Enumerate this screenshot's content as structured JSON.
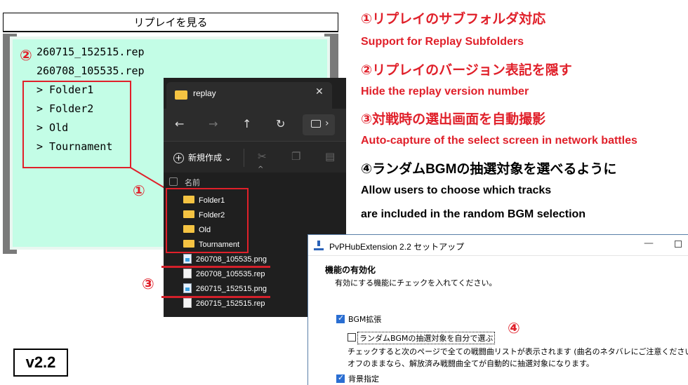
{
  "replay": {
    "title": "リプレイを見る",
    "files": [
      "260715_152515.rep",
      "260708_105535.rep"
    ],
    "folders": [
      "> Folder1",
      "> Folder2",
      "> Old",
      "> Tournament"
    ]
  },
  "explorer": {
    "tab_title": "replay",
    "new_label": "新規作成",
    "column_name": "名前",
    "folders": [
      "Folder1",
      "Folder2",
      "Old",
      "Tournament"
    ],
    "files": [
      "260708_105535.png",
      "260708_105535.rep",
      "260715_152515.png",
      "260715_152515.rep"
    ]
  },
  "annotations": {
    "mark1": "①",
    "mark2": "②",
    "mark3": "③",
    "mark4": "④"
  },
  "notes": {
    "n1_jp": "①リプレイのサブフォルダ対応",
    "n1_en": "Support for Replay Subfolders",
    "n2_jp": "②リプレイのバージョン表記を隠す",
    "n2_en": "Hide the replay version number",
    "n3_jp": "③対戦時の選出画面を自動撮影",
    "n3_en": "Auto-capture of the select screen in network battles",
    "n4_jp": "④ランダムBGMの抽選対象を選べるように",
    "n4_en1": "Allow users to choose which tracks",
    "n4_en2": " are included in the random BGM selection"
  },
  "setup": {
    "title": "PvPHubExtension 2.2 セットアップ",
    "heading": "機能の有効化",
    "subheading": "有効にする機能にチェックを入れてください。",
    "opt1_label": "BGM拡張",
    "opt1_checked": true,
    "opt2_label": "ランダムBGMの抽選対象を自分で選ぶ",
    "opt2_checked": false,
    "desc1": "チェックすると次のページで全ての戦闘曲リストが表示されます (曲名のネタバレにご注意ください)。",
    "desc2": "オフのままなら、解放済み戦闘曲全てが自動的に抽選対象になります。",
    "opt3_label": "背景指定",
    "opt3_checked": true
  },
  "version": "v2.2",
  "colors": {
    "accent_red": "#e0202a",
    "replay_bg": "#c3fde6",
    "explorer_bg": "#1f1f1f",
    "folder_yellow": "#f5c342",
    "checkbox_blue": "#2a6ed2"
  }
}
